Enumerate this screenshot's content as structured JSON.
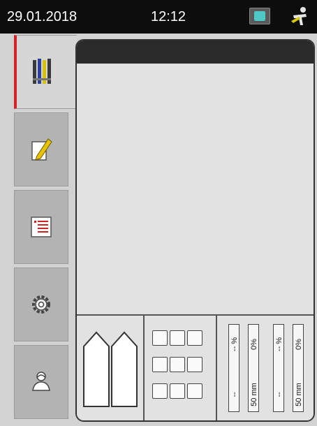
{
  "statusbar": {
    "date": "29.01.2018",
    "time": "12:12",
    "network_icon": "network-status-icon",
    "user_icon": "user-supervisor-icon"
  },
  "sidebar": {
    "items": [
      {
        "icon": "reagents-icon",
        "active": true
      },
      {
        "icon": "edit-sheet-icon",
        "active": false
      },
      {
        "icon": "program-list-icon",
        "active": false
      },
      {
        "icon": "settings-gear-icon",
        "active": false
      },
      {
        "icon": "user-icon",
        "active": false
      }
    ]
  },
  "footer": {
    "level_indicators": [
      {
        "top": "-- %",
        "right_top": "0%",
        "right_bottom": "50 mm",
        "left_bottom": "--"
      },
      {
        "top": "-- %",
        "right_top": "0%",
        "right_bottom": "50 mm",
        "left_bottom": "--"
      }
    ]
  },
  "colors": {
    "statusbar_bg": "#0d0d0d",
    "active_accent": "#d2232a",
    "panel_bg": "#e2e2e2",
    "sidebar_tab": "#b3b3b3"
  }
}
